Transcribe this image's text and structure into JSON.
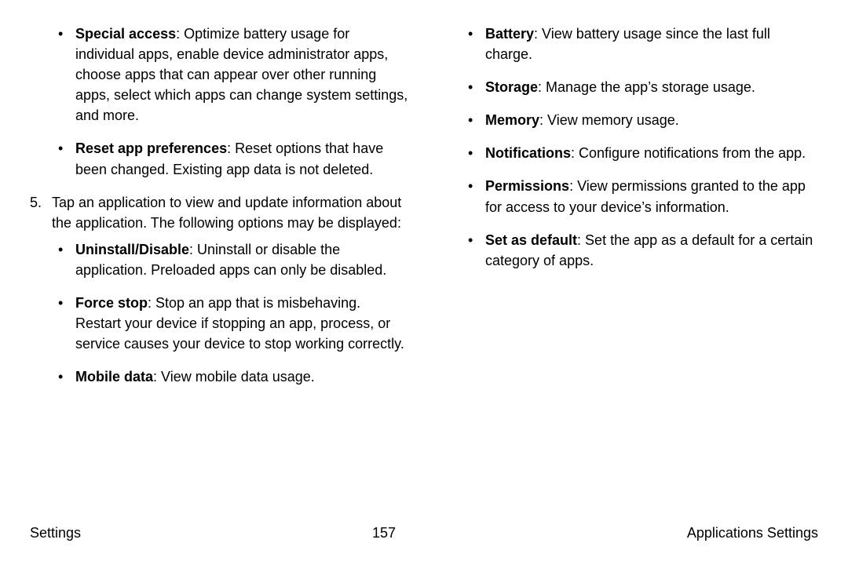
{
  "leftColumn": {
    "topBullets": [
      {
        "term": "Special access",
        "desc": ": Optimize battery usage for individual apps, enable device administrator apps, choose apps that can appear over other running apps, select which apps can change system settings, and more."
      },
      {
        "term": "Reset app preferences",
        "desc": ": Reset options that have been changed. Existing app data is not deleted."
      }
    ],
    "num": "5.",
    "numText": "Tap an application to view and update information about the application. The following options may be displayed:",
    "subBullets": [
      {
        "term": "Uninstall/Disable",
        "desc": ": Uninstall or disable the application. Preloaded apps can only be disabled."
      },
      {
        "term": "Force stop",
        "desc": ": Stop an app that is misbehaving. Restart your device if stopping an app, process, or service causes your device to stop working correctly."
      },
      {
        "term": "Mobile data",
        "desc": ": View mobile data usage."
      }
    ]
  },
  "rightColumn": {
    "bullets": [
      {
        "term": "Battery",
        "desc": ": View battery usage since the last full charge."
      },
      {
        "term": "Storage",
        "desc": ": Manage the app’s storage usage."
      },
      {
        "term": "Memory",
        "desc": ": View memory usage."
      },
      {
        "term": "Notifications",
        "desc": ": Configure notifications from the app."
      },
      {
        "term": "Permissions",
        "desc": ": View permissions granted to the app for access to your device’s information."
      },
      {
        "term": "Set as default",
        "desc": ": Set the app as a default for a certain category of apps."
      }
    ]
  },
  "footer": {
    "left": "Settings",
    "center": "157",
    "right": "Applications Settings"
  }
}
